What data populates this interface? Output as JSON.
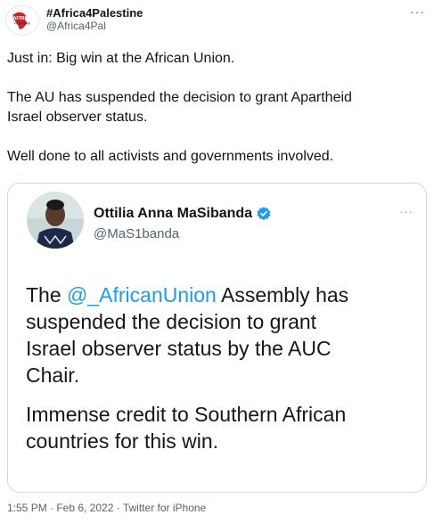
{
  "author": {
    "display_name": "#Africa4Palestine",
    "handle": "@Africa4Pal",
    "avatar_icon": "africa4palestine-logo",
    "logo_text": "AFRICA",
    "logo_subtext": "PALESTINE"
  },
  "tweet": {
    "line1": "Just in: Big win at the African Union.",
    "line2a": "The AU has suspended the decision to grant Apartheid",
    "line2b": "Israel observer status.",
    "line3": "Well done to all activists and governments involved."
  },
  "quoted": {
    "display_name": "Ottilia Anna MaSibanda",
    "handle": "@MaS1banda",
    "verified_icon": "verified-badge-icon",
    "text_prefix": "The ",
    "mention": "@_AfricanUnion",
    "text_rest_1": " Assembly has",
    "line2": "suspended the decision to grant",
    "line3": "Israel observer status by the AUC",
    "line4": "Chair.",
    "para2_line1": "Immense credit to Southern African",
    "para2_line2": "countries for this win."
  },
  "meta": {
    "footer": "1:55 PM · Feb 6, 2022 · Twitter for iPhone"
  },
  "colors": {
    "link": "#1d9bf0",
    "secondary_text": "#536471",
    "border": "#cfd9de",
    "logo_red": "#d0202b"
  }
}
